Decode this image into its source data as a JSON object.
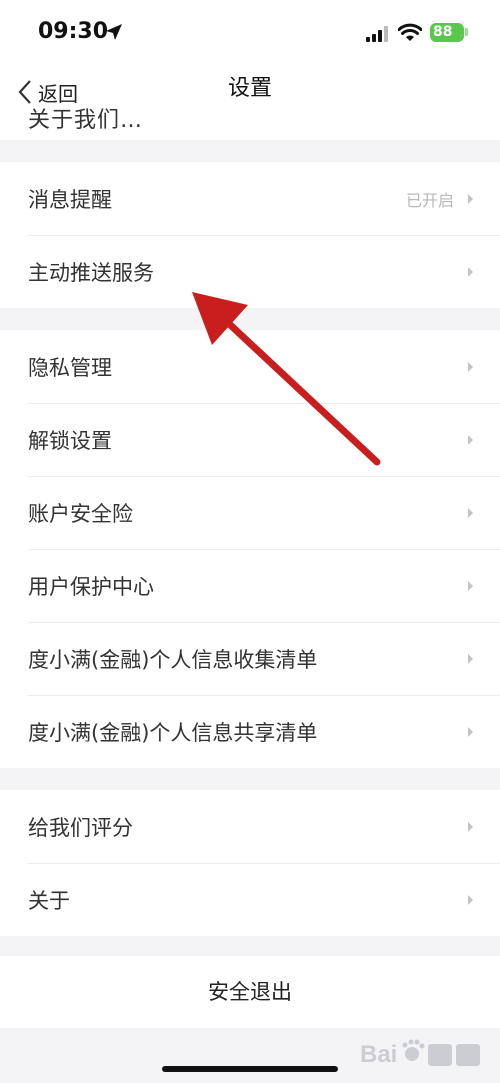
{
  "status": {
    "time": "09:30",
    "battery": "88"
  },
  "nav": {
    "back_label": "返回",
    "title": "设置",
    "partial_item": "关于我们…"
  },
  "groups": [
    {
      "items": [
        {
          "label": "消息提醒",
          "value": "已开启"
        },
        {
          "label": "主动推送服务"
        }
      ]
    },
    {
      "items": [
        {
          "label": "隐私管理"
        },
        {
          "label": "解锁设置"
        },
        {
          "label": "账户安全险"
        },
        {
          "label": "用户保护中心"
        },
        {
          "label": "度小满(金融)个人信息收集清单"
        },
        {
          "label": "度小满(金融)个人信息共享清单"
        }
      ]
    },
    {
      "items": [
        {
          "label": "给我们评分"
        },
        {
          "label": "关于"
        }
      ]
    }
  ],
  "logout_label": "安全退出",
  "colors": {
    "arrow": "#c81e1e",
    "battery": "#5ac84f"
  }
}
